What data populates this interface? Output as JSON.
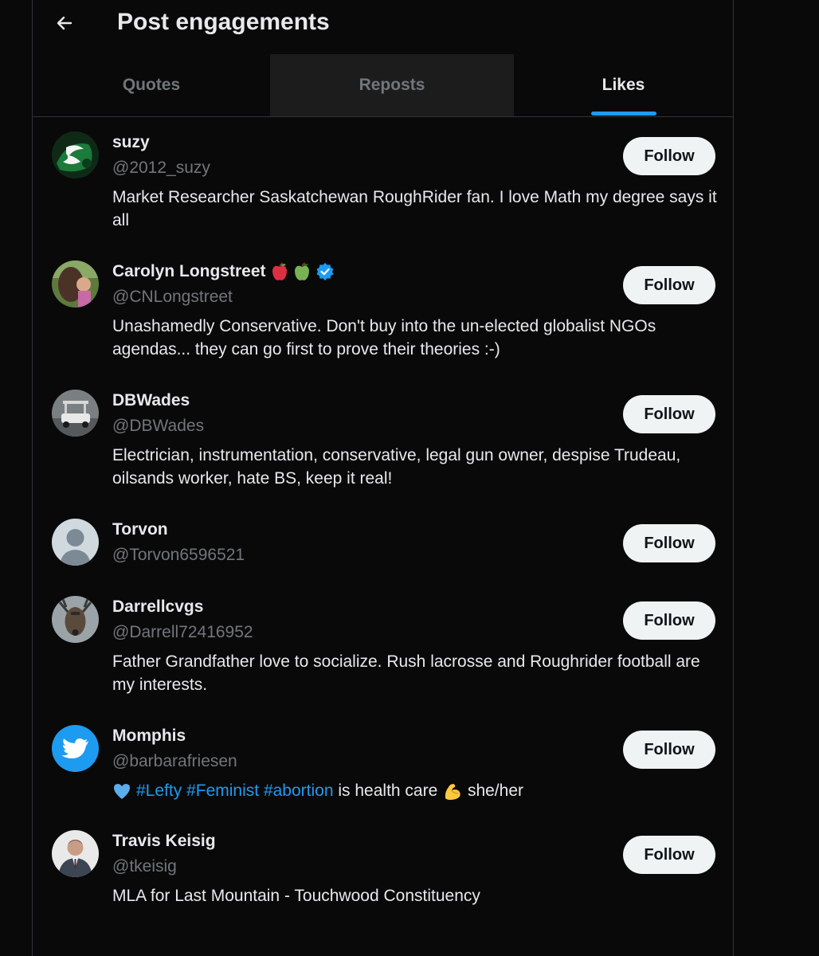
{
  "header": {
    "title": "Post engagements"
  },
  "tabs": [
    {
      "label": "Quotes"
    },
    {
      "label": "Reposts"
    },
    {
      "label": "Likes"
    }
  ],
  "follow_label": "Follow",
  "users": [
    {
      "name": "suzy",
      "handle": "@2012_suzy",
      "bio": "Market Researcher Saskatchewan RoughRider fan. I love Math my degree says it all"
    },
    {
      "name": "Carolyn Longstreet",
      "handle": "@CNLongstreet",
      "bio": "Unashamedly Conservative. Don't buy into the un-elected globalist NGOs agendas... they can go first to prove their theories :-)",
      "name_emoji": [
        "red-apple-icon",
        "green-apple-icon"
      ],
      "verified": true
    },
    {
      "name": "DBWades",
      "handle": "@DBWades",
      "bio": "Electrician, instrumentation, conservative, legal gun owner, despise Trudeau, oilsands worker, hate BS, keep it real!"
    },
    {
      "name": "Torvon",
      "handle": "@Torvon6596521",
      "bio": ""
    },
    {
      "name": "Darrellcvgs",
      "handle": "@Darrell72416952",
      "bio": "Father Grandfather love to socialize. Rush lacrosse and Roughrider football are my interests."
    },
    {
      "name": "Momphis",
      "handle": "@barbarafriesen",
      "bio_parts": {
        "tag1": "#Lefty",
        "tag2": "#Feminist",
        "tag3": "#abortion",
        "text1": "is health care",
        "text2": "she/her"
      }
    },
    {
      "name": "Travis Keisig",
      "handle": "@tkeisig",
      "bio": "MLA for Last Mountain - Touchwood Constituency"
    }
  ],
  "colors": {
    "background": "#0a090a",
    "accent": "#1d9bf0",
    "muted": "#71767b",
    "text": "#e7e9ea",
    "button_bg": "#eff3f4"
  }
}
